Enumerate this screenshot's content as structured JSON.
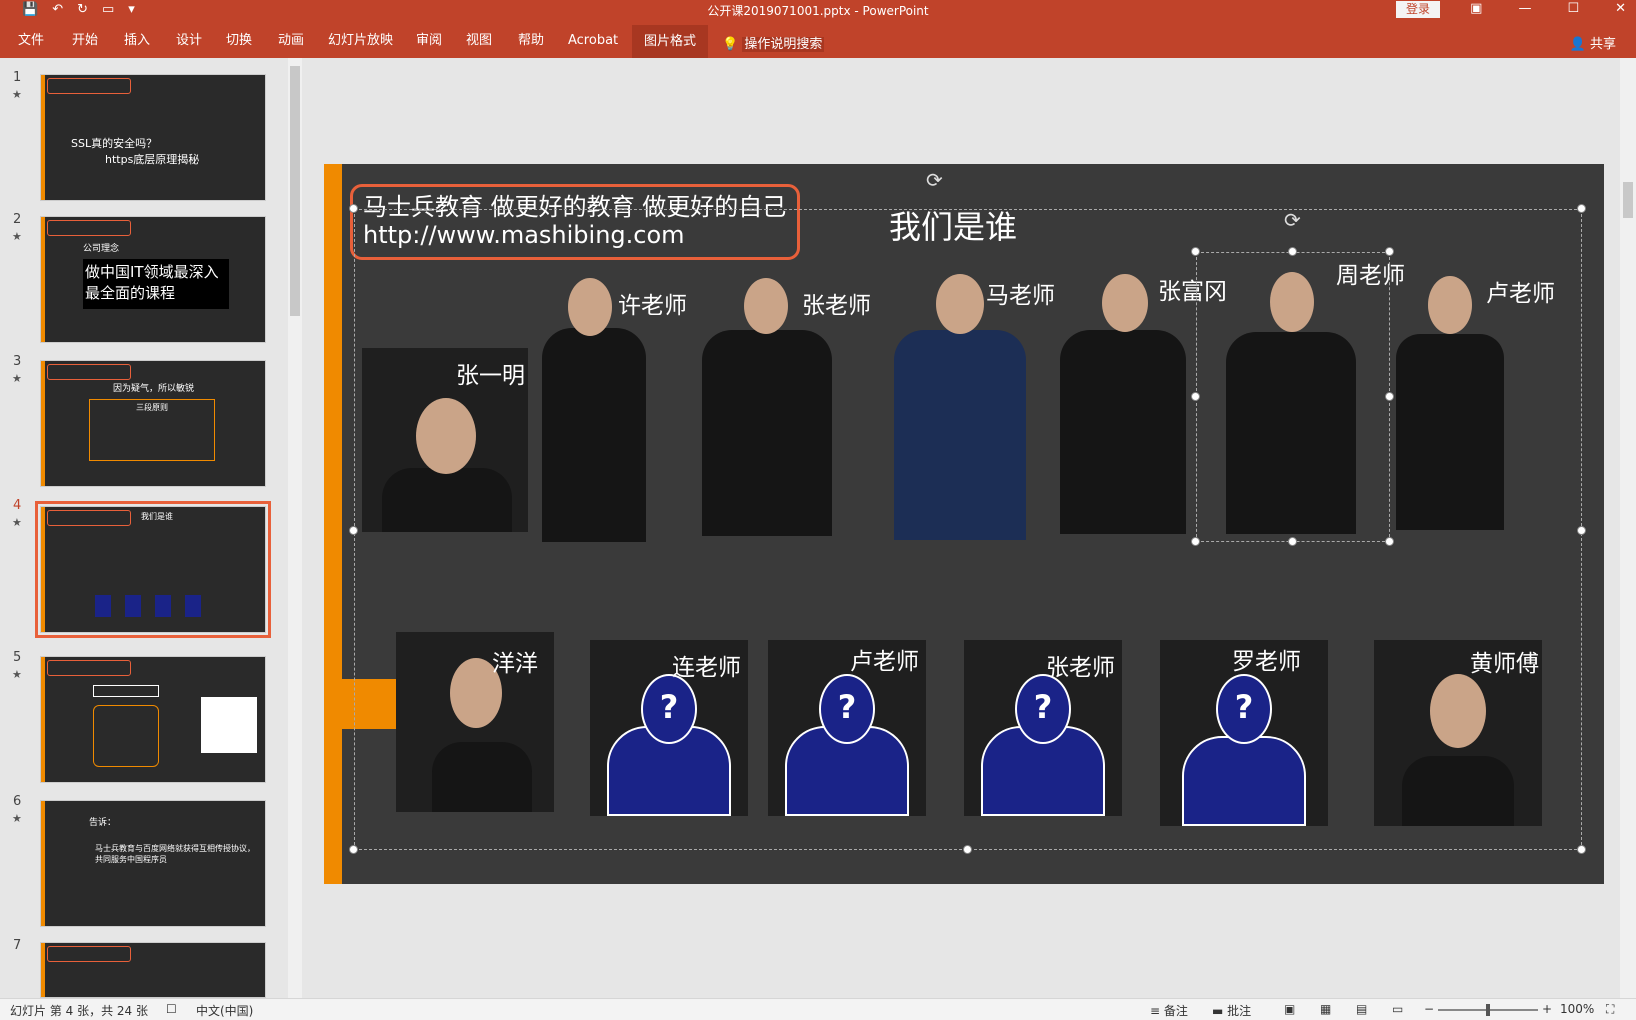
{
  "window": {
    "doc_title": "公开课2019071001.pptx  -  PowerPoint",
    "login_label": "登录",
    "win_controls": [
      "▣",
      "—",
      "☐",
      "✕"
    ]
  },
  "qat": [
    "save-icon",
    "undo-icon",
    "redo-icon",
    "slideshow-icon"
  ],
  "ribbon": {
    "tabs": [
      "文件",
      "开始",
      "插入",
      "设计",
      "切换",
      "动画",
      "幻灯片放映",
      "审阅",
      "视图",
      "帮助",
      "Acrobat",
      "图片格式"
    ],
    "active_tab": "图片格式",
    "tell_me": "操作说明搜索",
    "share": "共享"
  },
  "thumbnails": [
    {
      "num": "1",
      "line1": "SSL真的安全吗？",
      "line2": "https底层原理揭秘"
    },
    {
      "num": "2",
      "line1": "公司理念",
      "line2": "做中国IT领域最深入最全面的课程"
    },
    {
      "num": "3",
      "line1": "因为疑气，所以敏锐",
      "line2": "三段原则"
    },
    {
      "num": "4",
      "line1": "我们是谁",
      "line2": ""
    },
    {
      "num": "5",
      "line1": "",
      "line2": ""
    },
    {
      "num": "6",
      "line1": "告诉：",
      "line2": "马士兵教育与百度网络就获得互相传授协议，共同服务中国程序员"
    },
    {
      "num": "7",
      "line1": "",
      "line2": ""
    }
  ],
  "slide": {
    "header_line1": "马士兵教育 做更好的教育 做更好的自己",
    "header_line2": "http://www.mashibing.com",
    "title": "我们是谁",
    "top_row": [
      "张一明",
      "许老师",
      "张老师",
      "马老师",
      "张富冈",
      "周老师",
      "卢老师"
    ],
    "bottom_row": [
      "洋洋",
      "连老师",
      "卢老师",
      "张老师",
      "罗老师",
      "黄师傅"
    ],
    "unknown_mark": "?"
  },
  "status": {
    "slide_info": "幻灯片 第 4 张，共 24 张",
    "language": "中文(中国)",
    "notes": "备注",
    "comments": "批注",
    "zoom": "100%"
  }
}
